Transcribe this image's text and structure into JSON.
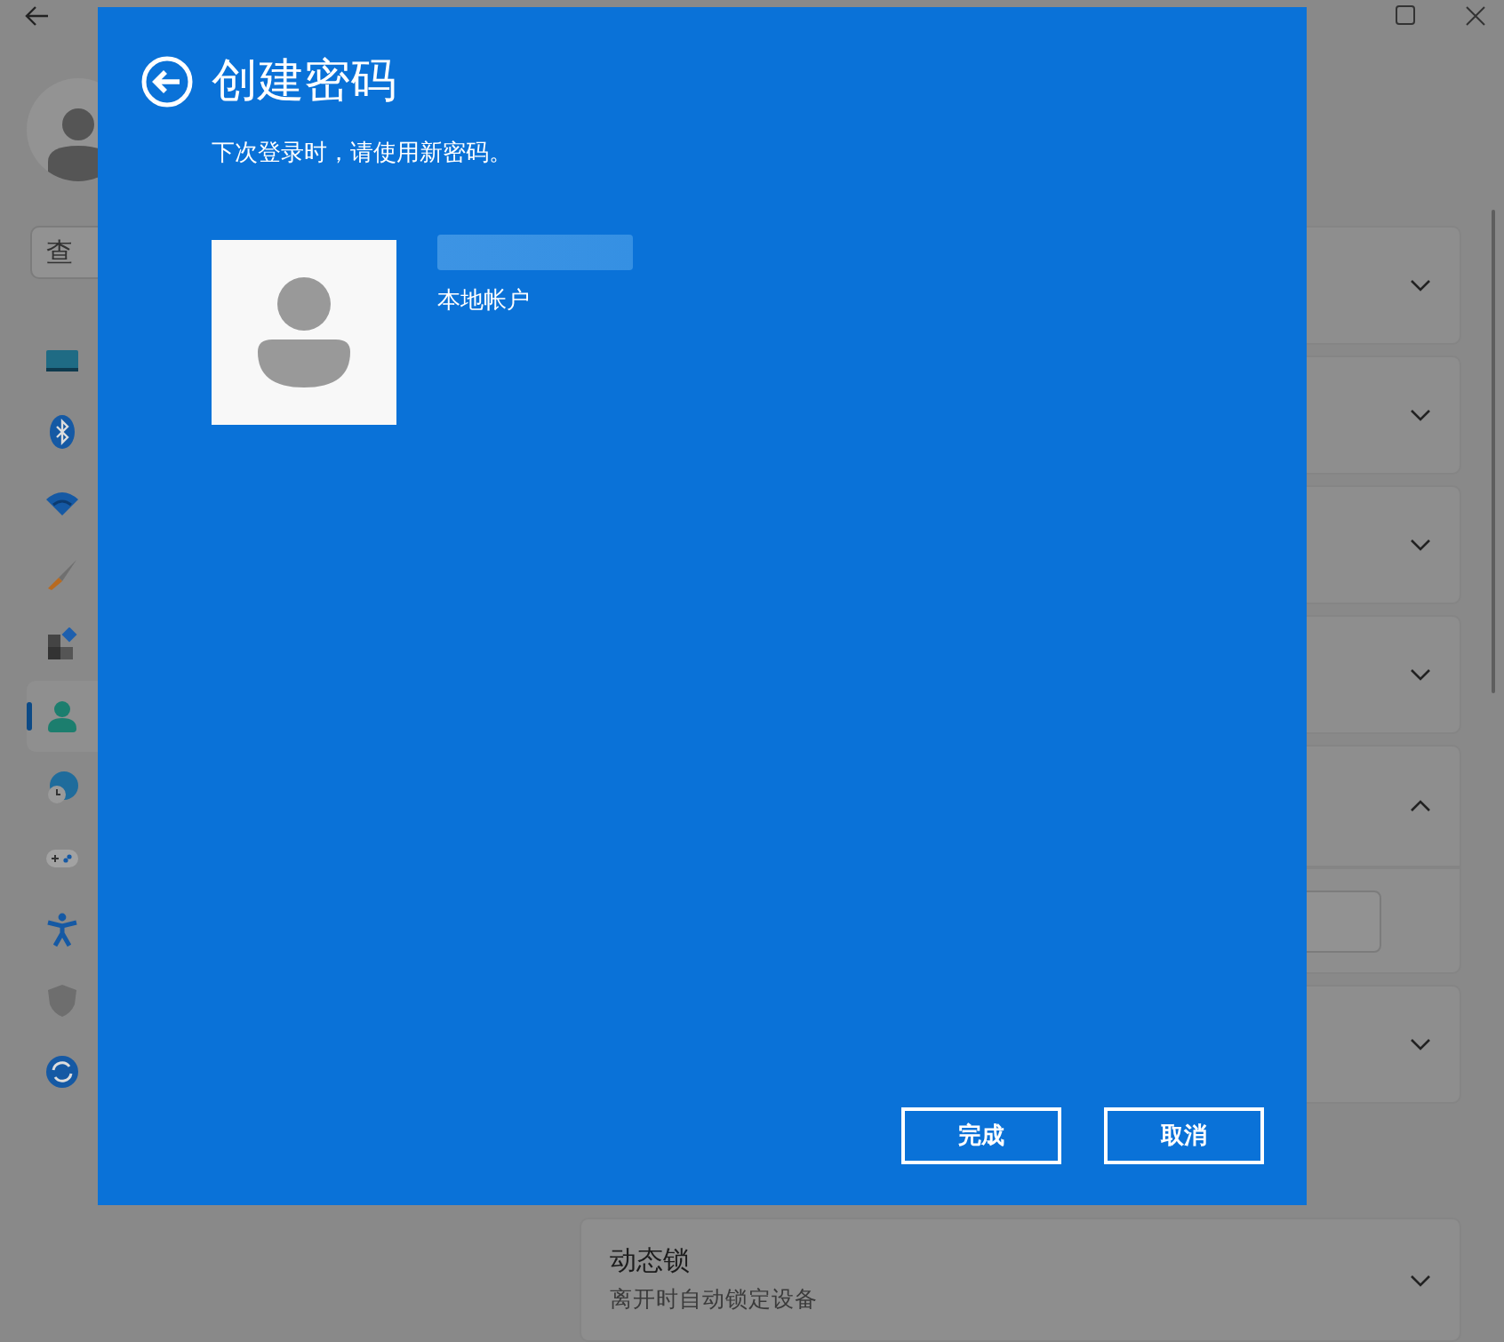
{
  "settings_window": {
    "search": {
      "placeholder": "查"
    },
    "nav_items": [
      {
        "kind": "display",
        "selected": false
      },
      {
        "kind": "bluetooth",
        "selected": false
      },
      {
        "kind": "wifi",
        "selected": false
      },
      {
        "kind": "brush",
        "selected": false
      },
      {
        "kind": "apps",
        "selected": false
      },
      {
        "kind": "account",
        "selected": true
      },
      {
        "kind": "time",
        "selected": false
      },
      {
        "kind": "gaming",
        "selected": false
      },
      {
        "kind": "accessibility",
        "selected": false
      },
      {
        "kind": "shield",
        "selected": false
      },
      {
        "kind": "update",
        "selected": false
      }
    ],
    "cards": [
      {
        "expanded": false
      },
      {
        "expanded": false
      },
      {
        "expanded": false
      },
      {
        "expanded": false
      },
      {
        "expanded": true
      },
      {
        "expanded": false
      }
    ],
    "other_card": {
      "title": "动态锁",
      "description": "离开时自动锁定设备"
    }
  },
  "dialog": {
    "title": "创建密码",
    "subtitle": "下次登录时，请使用新密码。",
    "account_type": "本地帐户",
    "buttons": [
      {
        "label": "完成"
      },
      {
        "label": "取消"
      }
    ]
  }
}
